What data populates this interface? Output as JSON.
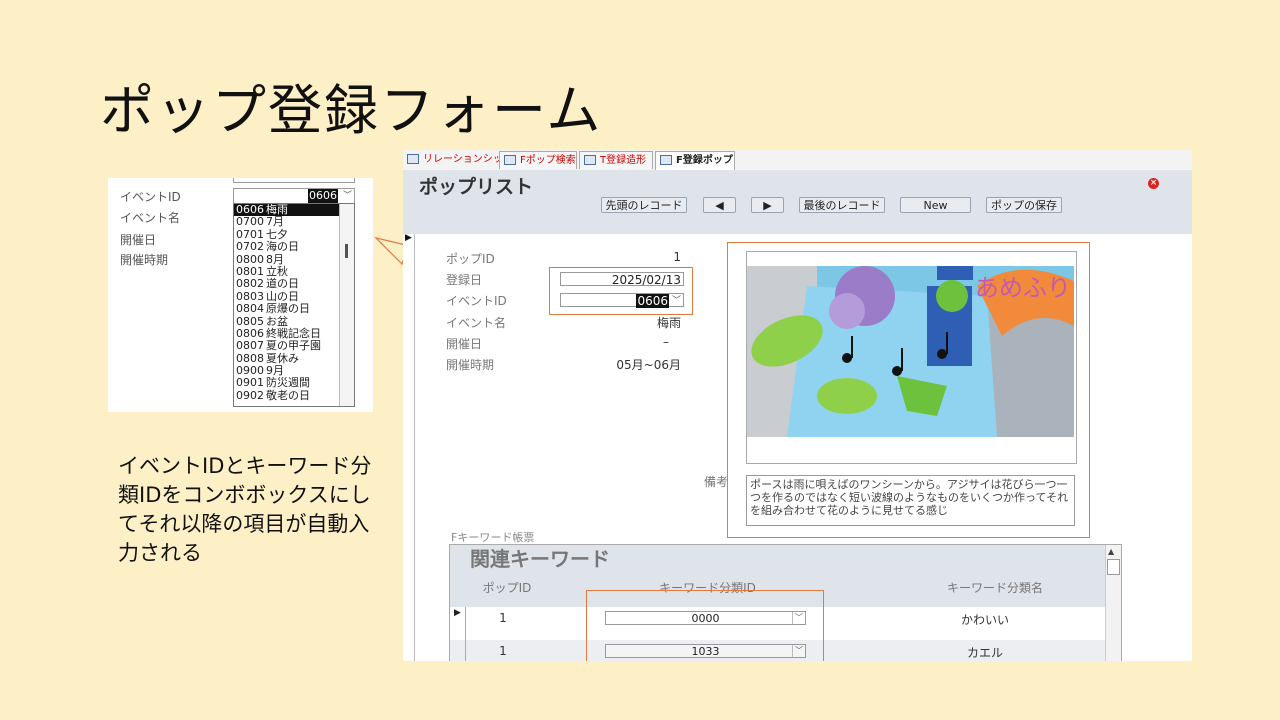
{
  "slide": {
    "title": "ポップ登録フォーム",
    "caption": "イベントIDとキーワード分類IDをコンボボックスにしてそれ以降の項目が自動入力される"
  },
  "inset": {
    "labels": [
      "イベントID",
      "イベント名",
      "開催日",
      "開催時期"
    ],
    "combo_value": "0606",
    "options": [
      {
        "code": "0606",
        "name": "梅雨"
      },
      {
        "code": "0700",
        "name": "7月"
      },
      {
        "code": "0701",
        "name": "七夕"
      },
      {
        "code": "0702",
        "name": "海の日"
      },
      {
        "code": "0800",
        "name": "8月"
      },
      {
        "code": "0801",
        "name": "立秋"
      },
      {
        "code": "0802",
        "name": "道の日"
      },
      {
        "code": "0803",
        "name": "山の日"
      },
      {
        "code": "0804",
        "name": "原爆の日"
      },
      {
        "code": "0805",
        "name": "お盆"
      },
      {
        "code": "0806",
        "name": "終戦記念日"
      },
      {
        "code": "0807",
        "name": "夏の甲子園"
      },
      {
        "code": "0808",
        "name": "夏休み"
      },
      {
        "code": "0900",
        "name": "9月"
      },
      {
        "code": "0901",
        "name": "防災週間"
      },
      {
        "code": "0902",
        "name": "敬老の日"
      }
    ],
    "selected_index": 0
  },
  "access": {
    "tabs": [
      "リレーションシップ",
      "Fポップ検索",
      "T登録造形",
      "F登録ポップ"
    ],
    "form_title": "ポップリスト",
    "buttons": {
      "first": "先頭のレコード",
      "prev": "◀",
      "next": "▶",
      "last": "最後のレコード",
      "new": "New",
      "save": "ポップの保存"
    },
    "fields": {
      "pop_id_label": "ポップID",
      "pop_id": "1",
      "reg_date_label": "登録日",
      "reg_date": "2025/02/13",
      "event_id_label": "イベントID",
      "event_id": "0606",
      "event_name_label": "イベント名",
      "event_name": "梅雨",
      "date_label": "開催日",
      "date": "–",
      "period_label": "開催時期",
      "period": "05月~06月"
    },
    "remarks_label": "備考",
    "remarks": "ポースは雨に唄えばのワンシーンから。アジサイは花びら一つ一つを作るのではなく短い波線のようなものをいくつか作ってそれを組み合わせて花のように見せてる感じ",
    "image_text": "あめふり",
    "subform_caption": "Fキーワード帳票",
    "subform": {
      "title": "関連キーワード",
      "columns": [
        "ポップID",
        "キーワード分類ID",
        "キーワード分類名"
      ],
      "rows": [
        {
          "pop_id": "1",
          "kw_id": "0000",
          "kw_name": "かわいい"
        },
        {
          "pop_id": "1",
          "kw_id": "1033",
          "kw_name": "カエル"
        }
      ]
    }
  },
  "colors": {
    "background": "#fdefc6",
    "highlight": "#e07a3f",
    "header": "#dfe3ea"
  }
}
